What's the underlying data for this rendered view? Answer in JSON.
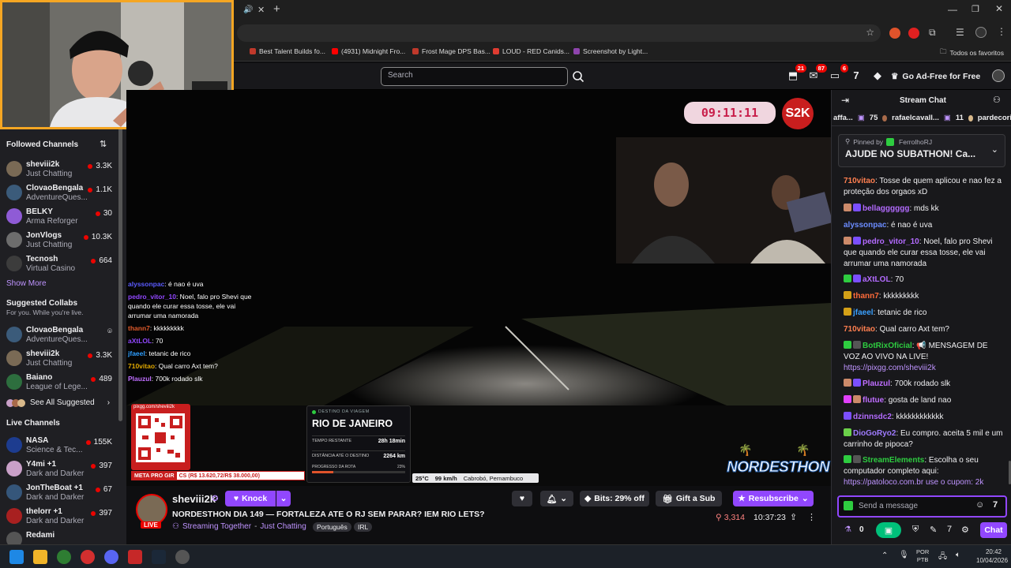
{
  "browser": {
    "tab_title": "",
    "bookmarks": [
      {
        "label": "Best Talent Builds fo...",
        "color": "#c0392b"
      },
      {
        "label": "(4931) Midnight Fro...",
        "color": "#ff0000"
      },
      {
        "label": "Frost Mage DPS Bas...",
        "color": "#c0392b"
      },
      {
        "label": "LOUD - RED Canids...",
        "color": "#e03c31"
      },
      {
        "label": "Screenshot by Light...",
        "color": "#8e44ad"
      }
    ],
    "all_favorites": "Todos os favoritos"
  },
  "topnav": {
    "search_placeholder": "Search",
    "badges": {
      "notifications": "21",
      "inbox": "87",
      "whispers": "6"
    },
    "adfree_label": "Go Ad-Free for Free"
  },
  "sidebar": {
    "followed_title": "Followed Channels",
    "followed": [
      {
        "name": "sheviii2k",
        "game": "Just Chatting",
        "viewers": "3.3K",
        "color": "#7a6a55"
      },
      {
        "name": "ClovaoBengala",
        "game": "AdventureQues...",
        "viewers": "1.1K",
        "color": "#3b5b7a"
      },
      {
        "name": "BELKY",
        "game": "Arma Reforger",
        "viewers": "30",
        "color": "#8f5bd6"
      },
      {
        "name": "JonVlogs",
        "game": "Just Chatting",
        "viewers": "10.3K",
        "color": "#6d6d6d"
      },
      {
        "name": "Tecnosh",
        "game": "Virtual Casino",
        "viewers": "664",
        "color": "#3c3c3c"
      }
    ],
    "show_more": "Show More",
    "suggested_title": "Suggested Collabs",
    "suggested_sub": "For you. While you're live.",
    "suggested": [
      {
        "name": "ClovaoBengala",
        "game": "AdventureQues...",
        "viewers": "",
        "color": "#3b5b7a"
      },
      {
        "name": "sheviii2k",
        "game": "Just Chatting",
        "viewers": "3.3K",
        "color": "#7a6a55"
      },
      {
        "name": "Baiano",
        "game": "League of Lege...",
        "viewers": "489",
        "color": "#2d6e3e"
      }
    ],
    "see_all": "See All Suggested",
    "live_title": "Live Channels",
    "live": [
      {
        "name": "NASA",
        "game": "Science & Tec...",
        "viewers": "155K",
        "color": "#1d3c8f"
      },
      {
        "name": "Y4mi +1",
        "game": "Dark and Darker",
        "viewers": "397",
        "color": "#c9a0c8"
      },
      {
        "name": "JonTheBoat +1",
        "game": "Dark and Darker",
        "viewers": "67",
        "color": "#35567a"
      },
      {
        "name": "thelorr +1",
        "game": "Dark and Darker",
        "viewers": "397",
        "color": "#a82020"
      },
      {
        "name": "Redami",
        "game": "",
        "viewers": "",
        "color": "#555"
      }
    ]
  },
  "video": {
    "timer": "09:11:11",
    "overlay_chat": [
      {
        "user": "alyssonpac",
        "text": ": é nao é uva",
        "color": "#5b5bff"
      },
      {
        "user": "pedro_vitor_10",
        "text": ": Noel, falo pro Shevi que quando ele curar essa tosse, ele vai arrumar uma namorada",
        "color": "#9147ff"
      },
      {
        "user": "thann7",
        "text": ": kkkkkkkkk",
        "color": "#e05b2b"
      },
      {
        "user": "aXtLOL",
        "text": ": 70",
        "color": "#9147ff"
      },
      {
        "user": "jfaeel",
        "text": ": tetanic de rico",
        "color": "#2e9fff"
      },
      {
        "user": "710vitao",
        "text": ": Qual carro Axt tem?",
        "color": "#e0a800"
      },
      {
        "user": "Plauzul",
        "text": ": 700k rodado slk",
        "color": "#bf6eff"
      }
    ],
    "qr_url": "pixgg.com/sheviii2k",
    "goal_text": "META PRO GIR",
    "goal_values": "CS (R$ 13.620,72/R$ 38.000,00)",
    "trip_header": "DESTINO DA VIAGEM",
    "trip_destination": "RIO DE JANEIRO",
    "trip_time_label": "TEMPO RESTANTE",
    "trip_time_value": "28h 18min",
    "trip_dist_label": "DISTÂNCIA ATÉ O DESTINO",
    "trip_dist_value": "2264 km",
    "trip_progress_label": "PROGRESSO DA ROTA",
    "trip_progress_value": "23%",
    "trip_progress": 0.23,
    "temp": "25°C",
    "speed": "99 km/h",
    "location": "Cabrobó, Pernambuco",
    "brand": "NORDESTHON"
  },
  "info": {
    "channel": "sheviii2k",
    "knock_label": "Knock",
    "live_label": "LIVE",
    "title": "NORDESTHON DIA 149 — FORTALEZA ATE O RJ SEM PARAR? IEM RIO LETS?",
    "category": "Streaming Together",
    "category2": "Just Chatting",
    "tags": [
      "Português",
      "IRL"
    ],
    "bits_label": "Bits: 29% off",
    "gift_label": "Gift a Sub",
    "resub_label": "Resubscribe",
    "viewers": "3,314",
    "uptime": "10:37:23"
  },
  "chat": {
    "title": "Stream Chat",
    "leaderboard": [
      {
        "name": "affa...",
        "count": "75"
      },
      {
        "name": "rafaelcavall...",
        "count": "11"
      },
      {
        "name": "pardecori",
        "count": ""
      }
    ],
    "pinned_by_label": "Pinned by",
    "pinned_by": "FerrolhoRJ",
    "pinned_text": "AJUDE NO SUBATHON! Ca...",
    "messages": [
      {
        "user": "710vitao",
        "text": ": Tosse de quem aplicou e nao fez a proteção dos orgaos xD",
        "color": "#ff7f50",
        "badges": []
      },
      {
        "user": "bellagggggg",
        "text": ": mds kk",
        "color": "#b36bff",
        "badges": [
          "#cc8a6a",
          "#7b4fff"
        ]
      },
      {
        "user": "alyssonpac",
        "text": ": é nao é uva",
        "color": "#6b8cff",
        "badges": []
      },
      {
        "user": "pedro_vitor_10",
        "text": ": Noel, falo pro Shevi que quando ele curar essa tosse, ele vai arrumar uma namorada",
        "color": "#b36bff",
        "badges": [
          "#cc8a6a",
          "#7b4fff"
        ]
      },
      {
        "user": "aXtLOL",
        "text": ": 70",
        "color": "#b36bff",
        "badges": [
          "#2ecc40",
          "#7b4fff"
        ]
      },
      {
        "user": "thann7",
        "text": ": kkkkkkkkk",
        "color": "#ff6b3a",
        "badges": [
          "#d4a017"
        ]
      },
      {
        "user": "jfaeel",
        "text": ": tetanic de rico",
        "color": "#3aa0ff",
        "badges": [
          "#d4a017"
        ]
      },
      {
        "user": "710vitao",
        "text": ": Qual carro Axt tem?",
        "color": "#ff7f50",
        "badges": []
      },
      {
        "user": "BotRixOficial",
        "text": ": 📢 MENSAGEM DE VOZ AO VIVO NA LIVE!",
        "color": "#2ecc40",
        "badges": [
          "#2ecc40",
          "#555"
        ]
      },
      {
        "user": "",
        "text": "https://pixgg.com/sheviii2k",
        "color": "#bf94ff",
        "badges": []
      },
      {
        "user": "Plauzul",
        "text": ": 700k rodado slk",
        "color": "#bf6eff",
        "badges": [
          "#cc8a6a",
          "#7b4fff"
        ]
      },
      {
        "user": "flutue",
        "text": ": gosta de land nao",
        "color": "#bf6eff",
        "badges": [
          "#e040fb",
          "#cc8a6a"
        ]
      },
      {
        "user": "dzinnsdc2",
        "text": ": kkkkkkkkkkkk",
        "color": "#b36bff",
        "badges": [
          "#7b4fff"
        ]
      },
      {
        "user": "DioGoRyo2",
        "text": ": Eu compro. aceita 5 mil e um carrinho de pipoca?",
        "color": "#9f7bff",
        "badges": [
          "#6bd04a"
        ]
      },
      {
        "user": "StreamElements",
        "text": ": Escolha o seu computador completo aqui:",
        "color": "#2ecc40",
        "badges": [
          "#2ecc40",
          "#555"
        ]
      },
      {
        "user": "",
        "text": "https://patoloco.com.br use o cupom: 2k",
        "color": "#bf94ff",
        "badges": []
      }
    ],
    "input_placeholder": "Send a message",
    "points": "0",
    "chat_button": "Chat"
  },
  "taskbar": {
    "lang": "POR",
    "layout": "PTB",
    "time": "20:42",
    "date": "10/04/2026"
  }
}
